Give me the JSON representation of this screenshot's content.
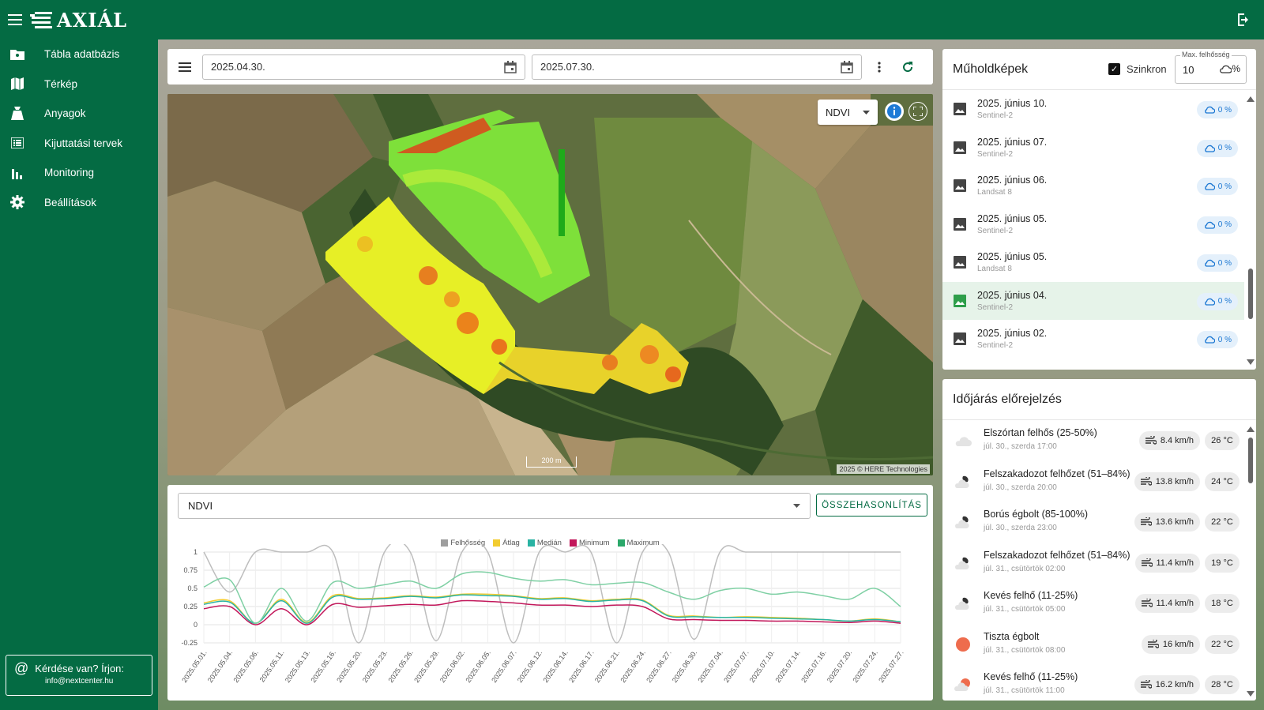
{
  "app": {
    "title": "AXIÁL"
  },
  "sidebar": {
    "items": [
      {
        "label": "Tábla adatbázis",
        "icon": "folder-icon"
      },
      {
        "label": "Térkép",
        "icon": "map-icon"
      },
      {
        "label": "Anyagok",
        "icon": "bag-icon"
      },
      {
        "label": "Kijuttatási tervek",
        "icon": "list-icon"
      },
      {
        "label": "Monitoring",
        "icon": "bar-chart-icon"
      },
      {
        "label": "Beállítások",
        "icon": "gear-icon"
      }
    ],
    "help": {
      "question": "Kérdése van? Írjon:",
      "email": "info@nextcenter.hu"
    }
  },
  "datebar": {
    "start": "2025.04.30.",
    "end": "2025.07.30."
  },
  "map": {
    "layer": "NDVI",
    "scale": "200 m",
    "attribution": "2025 © HERE Technologies"
  },
  "chart_panel": {
    "select_value": "NDVI",
    "compare_label": "ÖSSZEHASONLÍTÁS"
  },
  "chart_data": {
    "type": "line",
    "title": "",
    "xlabel": "",
    "ylabel": "",
    "ylim": [
      -0.25,
      1
    ],
    "yticks": [
      "1",
      "0.75",
      "0.5",
      "0.25",
      "0",
      "-0.25"
    ],
    "grid": true,
    "legend_position": "top",
    "categories": [
      "2025.05.01.",
      "2025.05.04.",
      "2025.05.06.",
      "2025.05.11.",
      "2025.05.13.",
      "2025.05.16.",
      "2025.05.20.",
      "2025.05.23.",
      "2025.05.26.",
      "2025.05.29.",
      "2025.06.02.",
      "2025.06.05.",
      "2025.06.07.",
      "2025.06.12.",
      "2025.06.14.",
      "2025.06.17.",
      "2025.06.21.",
      "2025.06.24.",
      "2025.06.27.",
      "2025.06.30.",
      "2025.07.04.",
      "2025.07.07.",
      "2025.07.10.",
      "2025.07.14.",
      "2025.07.16.",
      "2025.07.20.",
      "2025.07.24.",
      "2025.07.27."
    ],
    "series": [
      {
        "name": "Felhősség",
        "color": "#bdbdbd",
        "values": [
          1,
          0.45,
          1,
          1,
          1,
          1,
          -0.25,
          1,
          1,
          -0.22,
          1,
          1,
          -0.25,
          1,
          1,
          1,
          -0.25,
          1,
          1,
          -0.2,
          1,
          1,
          1,
          1,
          1,
          1,
          1,
          1
        ]
      },
      {
        "name": "Átlag",
        "color": "#f2cc30",
        "values": [
          0.3,
          0.33,
          0.02,
          0.35,
          0.03,
          0.4,
          0.36,
          0.37,
          0.4,
          0.38,
          0.42,
          0.42,
          0.4,
          0.36,
          0.37,
          0.33,
          0.35,
          0.34,
          0.13,
          0.12,
          0.1,
          0.11,
          0.1,
          0.09,
          0.07,
          0.05,
          0.08,
          0.04
        ]
      },
      {
        "name": "Medián",
        "color": "#2ab3a3",
        "values": [
          0.28,
          0.31,
          0.02,
          0.33,
          0.02,
          0.38,
          0.35,
          0.36,
          0.39,
          0.37,
          0.41,
          0.4,
          0.39,
          0.35,
          0.36,
          0.32,
          0.34,
          0.33,
          0.12,
          0.11,
          0.1,
          0.1,
          0.09,
          0.08,
          0.07,
          0.05,
          0.07,
          0.04
        ]
      },
      {
        "name": "Minimum",
        "color": "#c2185b",
        "values": [
          0.22,
          0.25,
          0.0,
          0.22,
          0.0,
          0.28,
          0.24,
          0.26,
          0.28,
          0.27,
          0.33,
          0.32,
          0.3,
          0.27,
          0.27,
          0.25,
          0.27,
          0.25,
          0.08,
          0.07,
          0.06,
          0.06,
          0.05,
          0.05,
          0.04,
          0.03,
          0.05,
          0.02
        ]
      },
      {
        "name": "Maximum",
        "color": "#7fd0a4",
        "values": [
          0.52,
          0.62,
          0.02,
          0.5,
          0.05,
          0.58,
          0.5,
          0.55,
          0.6,
          0.5,
          0.7,
          0.72,
          0.64,
          0.6,
          0.62,
          0.55,
          0.57,
          0.58,
          0.45,
          0.35,
          0.47,
          0.5,
          0.42,
          0.45,
          0.4,
          0.35,
          0.5,
          0.25
        ]
      }
    ]
  },
  "satellite": {
    "title": "Műholdképek",
    "sync_label": "Szinkron",
    "max_cloud_label": "Max. felhősség",
    "max_cloud_value": "10",
    "max_cloud_unit": "%",
    "items": [
      {
        "date": "2025. június 10.",
        "source": "Sentinel-2",
        "cloud": "0 %",
        "active": false
      },
      {
        "date": "2025. június 07.",
        "source": "Sentinel-2",
        "cloud": "0 %",
        "active": false
      },
      {
        "date": "2025. június 06.",
        "source": "Landsat 8",
        "cloud": "0 %",
        "active": false
      },
      {
        "date": "2025. június 05.",
        "source": "Sentinel-2",
        "cloud": "0 %",
        "active": false
      },
      {
        "date": "2025. június 05.",
        "source": "Landsat 8",
        "cloud": "0 %",
        "active": false
      },
      {
        "date": "2025. június 04.",
        "source": "Sentinel-2",
        "cloud": "0 %",
        "active": true
      },
      {
        "date": "2025. június 02.",
        "source": "Sentinel-2",
        "cloud": "0 %",
        "active": false
      }
    ]
  },
  "weather": {
    "title": "Időjárás előrejelzés",
    "items": [
      {
        "desc": "Elszórtan felhős (25-50%)",
        "time": "júl. 30., szerda 17:00",
        "wind": "8.4 km/h",
        "temp": "26 °C",
        "icon": "cloud-light-icon"
      },
      {
        "desc": "Felszakadozot felhőzet (51–84%)",
        "time": "júl. 30., szerda 20:00",
        "wind": "13.8 km/h",
        "temp": "24 °C",
        "icon": "cloud-night-icon"
      },
      {
        "desc": "Borús égbolt (85-100%)",
        "time": "júl. 30., szerda 23:00",
        "wind": "13.6 km/h",
        "temp": "22 °C",
        "icon": "cloud-night-icon"
      },
      {
        "desc": "Felszakadozot felhőzet (51–84%)",
        "time": "júl. 31., csütörtök 02:00",
        "wind": "11.4 km/h",
        "temp": "19 °C",
        "icon": "cloud-night-icon"
      },
      {
        "desc": "Kevés felhő (11-25%)",
        "time": "júl. 31., csütörtök 05:00",
        "wind": "11.4 km/h",
        "temp": "18 °C",
        "icon": "cloud-night-icon"
      },
      {
        "desc": "Tiszta égbolt",
        "time": "júl. 31., csütörtök 08:00",
        "wind": "16 km/h",
        "temp": "22 °C",
        "icon": "sun-icon"
      },
      {
        "desc": "Kevés felhő (11-25%)",
        "time": "júl. 31., csütörtök 11:00",
        "wind": "16.2 km/h",
        "temp": "28 °C",
        "icon": "sun-cloud-icon"
      }
    ]
  }
}
